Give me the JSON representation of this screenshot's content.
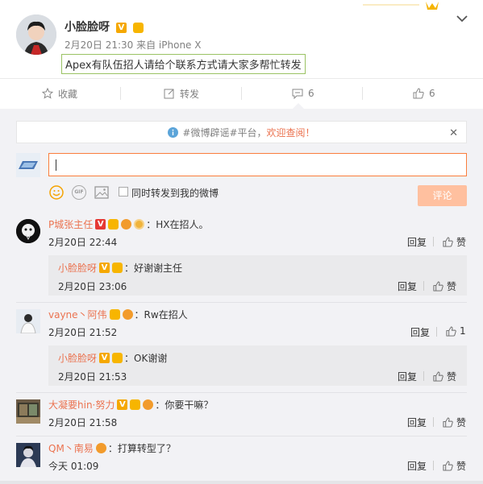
{
  "post": {
    "username": "小脸脸呀",
    "meta": "2月20日 21:30 来自 iPhone X",
    "text": "Apex有队伍招人请给个联系方式请大家多帮忙转发"
  },
  "actions": {
    "favorite": "收藏",
    "repost": "转发",
    "comment_count": "6",
    "like_count": "6"
  },
  "notice": {
    "prefix": "#微博辟谣#平台，",
    "link": "欢迎查阅！",
    "close": "✕"
  },
  "composer": {
    "repost_label": "同时转发到我的微博",
    "submit": "评论",
    "gif_label": "GIF"
  },
  "comments": [
    {
      "nick": "P城张主任",
      "text": "：HX在招人。",
      "time": "2月20日 22:44",
      "reply": "回复",
      "like": "赞",
      "reply_item": {
        "nick": "小脸脸呀",
        "text": "：好谢谢主任",
        "time": "2月20日 23:06",
        "reply": "回复",
        "like": "赞"
      }
    },
    {
      "nick": "vayne丶阿伟",
      "text": "：Rw在招人",
      "time": "2月20日 21:52",
      "reply": "回复",
      "like": "1",
      "reply_item": {
        "nick": "小脸脸呀",
        "text": "：OK谢谢",
        "time": "2月20日 21:53",
        "reply": "回复",
        "like": "赞"
      }
    },
    {
      "nick": "大凝要hin·努力",
      "text": "：你要干嘛？",
      "time": "2月20日 21:58",
      "reply": "回复",
      "like": "赞"
    },
    {
      "nick": "QM丶南易",
      "text": "：打算转型了？",
      "time": "今天 01:09",
      "reply": "回复",
      "like": "赞"
    }
  ],
  "colors": {
    "accent": "#eb7350",
    "border_focus": "#fa7d3c",
    "submit_disabled": "#ffc09f",
    "panel": "#f2f2f5",
    "vip_gold": "#f5a800"
  }
}
